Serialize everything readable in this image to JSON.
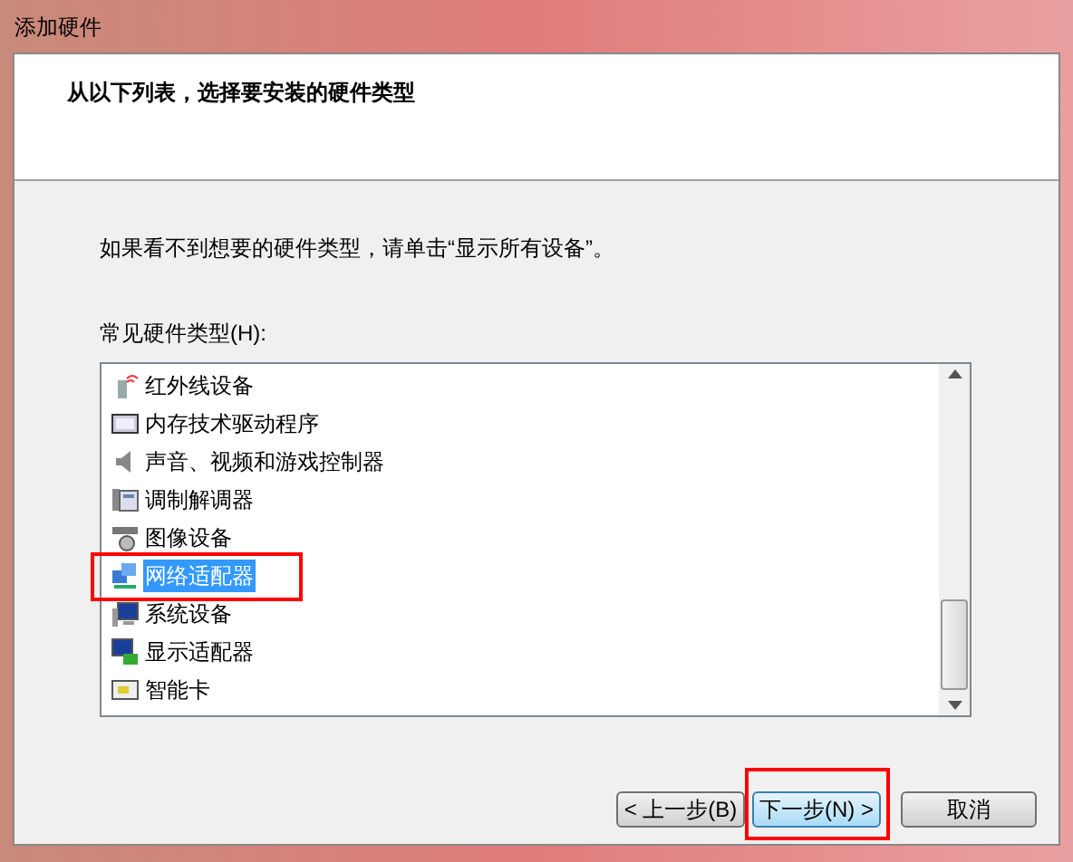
{
  "window": {
    "title": "添加硬件"
  },
  "header": {
    "heading": "从以下列表，选择要安装的硬件类型"
  },
  "hint": "如果看不到想要的硬件类型，请单击“显示所有设备”。",
  "list": {
    "label": "常见硬件类型(H):",
    "items": [
      {
        "kind": "infrared",
        "label": "红外线设备",
        "selected": false,
        "highlighted": false
      },
      {
        "kind": "memory",
        "label": "内存技术驱动程序",
        "selected": false,
        "highlighted": false
      },
      {
        "kind": "audio",
        "label": "声音、视频和游戏控制器",
        "selected": false,
        "highlighted": false
      },
      {
        "kind": "modem",
        "label": "调制解调器",
        "selected": false,
        "highlighted": false
      },
      {
        "kind": "imaging",
        "label": "图像设备",
        "selected": false,
        "highlighted": false
      },
      {
        "kind": "network",
        "label": "网络适配器",
        "selected": true,
        "highlighted": true
      },
      {
        "kind": "system",
        "label": "系统设备",
        "selected": false,
        "highlighted": false
      },
      {
        "kind": "display",
        "label": "显示适配器",
        "selected": false,
        "highlighted": false
      },
      {
        "kind": "smartcard",
        "label": "智能卡",
        "selected": false,
        "highlighted": false
      }
    ]
  },
  "buttons": [
    {
      "label": "< 上一步(B)",
      "default": false,
      "highlighted": false
    },
    {
      "label": "下一步(N) >",
      "default": true,
      "highlighted": true
    },
    {
      "label": "取消",
      "default": false,
      "highlighted": false
    }
  ]
}
